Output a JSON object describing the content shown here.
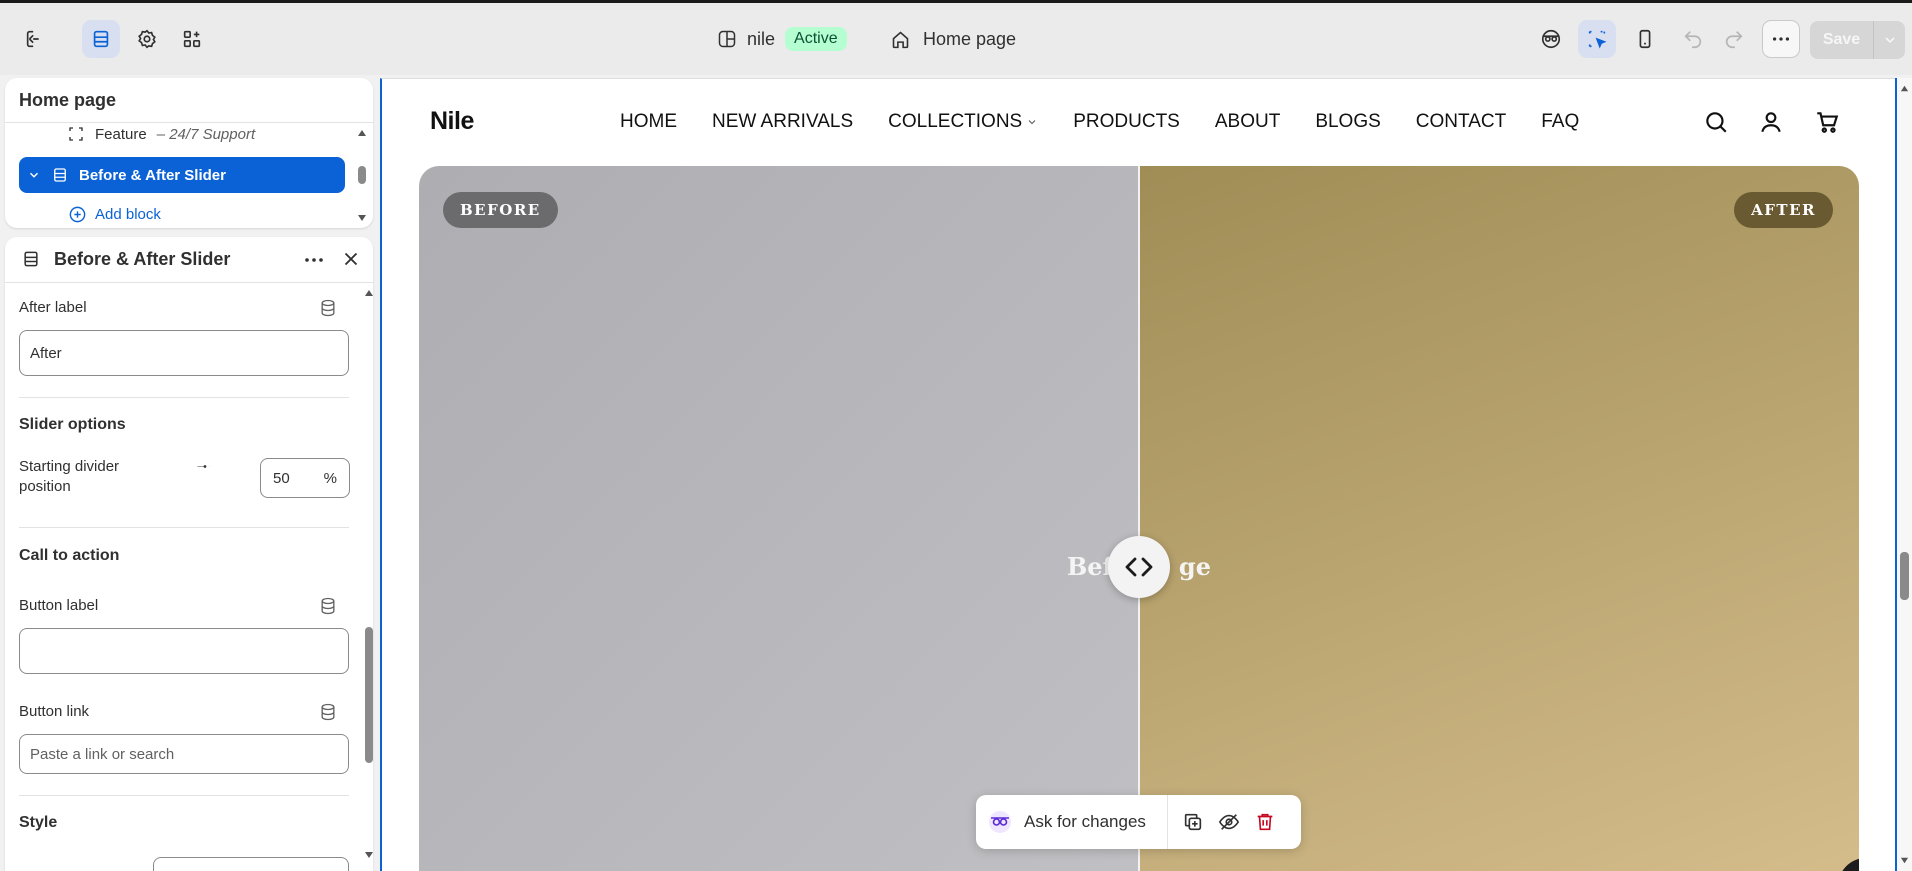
{
  "toolbar": {
    "theme_name": "nile",
    "theme_status": "Active",
    "page_name": "Home page",
    "save_label": "Save"
  },
  "sections_panel": {
    "title": "Home page",
    "feature_item": "Feature",
    "feature_detail": "– 24/7 Support",
    "selected_item": "Before & After Slider",
    "add_block_label": "Add block"
  },
  "settings_panel": {
    "title": "Before & After Slider",
    "after_label": {
      "label": "After label",
      "value": "After"
    },
    "slider_options": {
      "title": "Slider options",
      "divider_label": "Starting divider position",
      "divider_value": "50",
      "unit": "%",
      "slider_fraction": 0.5
    },
    "call_to_action": {
      "title": "Call to action",
      "button_label": {
        "label": "Button label",
        "value": ""
      },
      "button_link": {
        "label": "Button link",
        "placeholder": "Paste a link or search"
      }
    },
    "style": {
      "title": "Style"
    }
  },
  "preview": {
    "site_logo": "Nile",
    "nav": [
      "HOME",
      "NEW ARRIVALS",
      "COLLECTIONS",
      "PRODUCTS",
      "ABOUT",
      "BLOGS",
      "CONTACT",
      "FAQ"
    ],
    "before_badge": "BEFORE",
    "after_badge": "AFTER",
    "caption_left": "Bef",
    "caption_right": "ge",
    "ask_label": "Ask for changes"
  },
  "colors": {
    "accent": "#0b62d6",
    "active_badge_bg": "#b4fed2",
    "delete_red": "#c70a24"
  },
  "icons": [
    "exit-icon",
    "sections-icon",
    "settings-gear-icon",
    "apps-icon",
    "layout-icon",
    "home-icon",
    "inspector-icon",
    "select-cursor-icon",
    "mobile-icon",
    "undo-icon",
    "redo-icon",
    "more-icon",
    "chevron-down-icon",
    "database-icon",
    "search-icon",
    "account-icon",
    "cart-icon",
    "duplicate-icon",
    "hide-icon",
    "trash-icon"
  ]
}
